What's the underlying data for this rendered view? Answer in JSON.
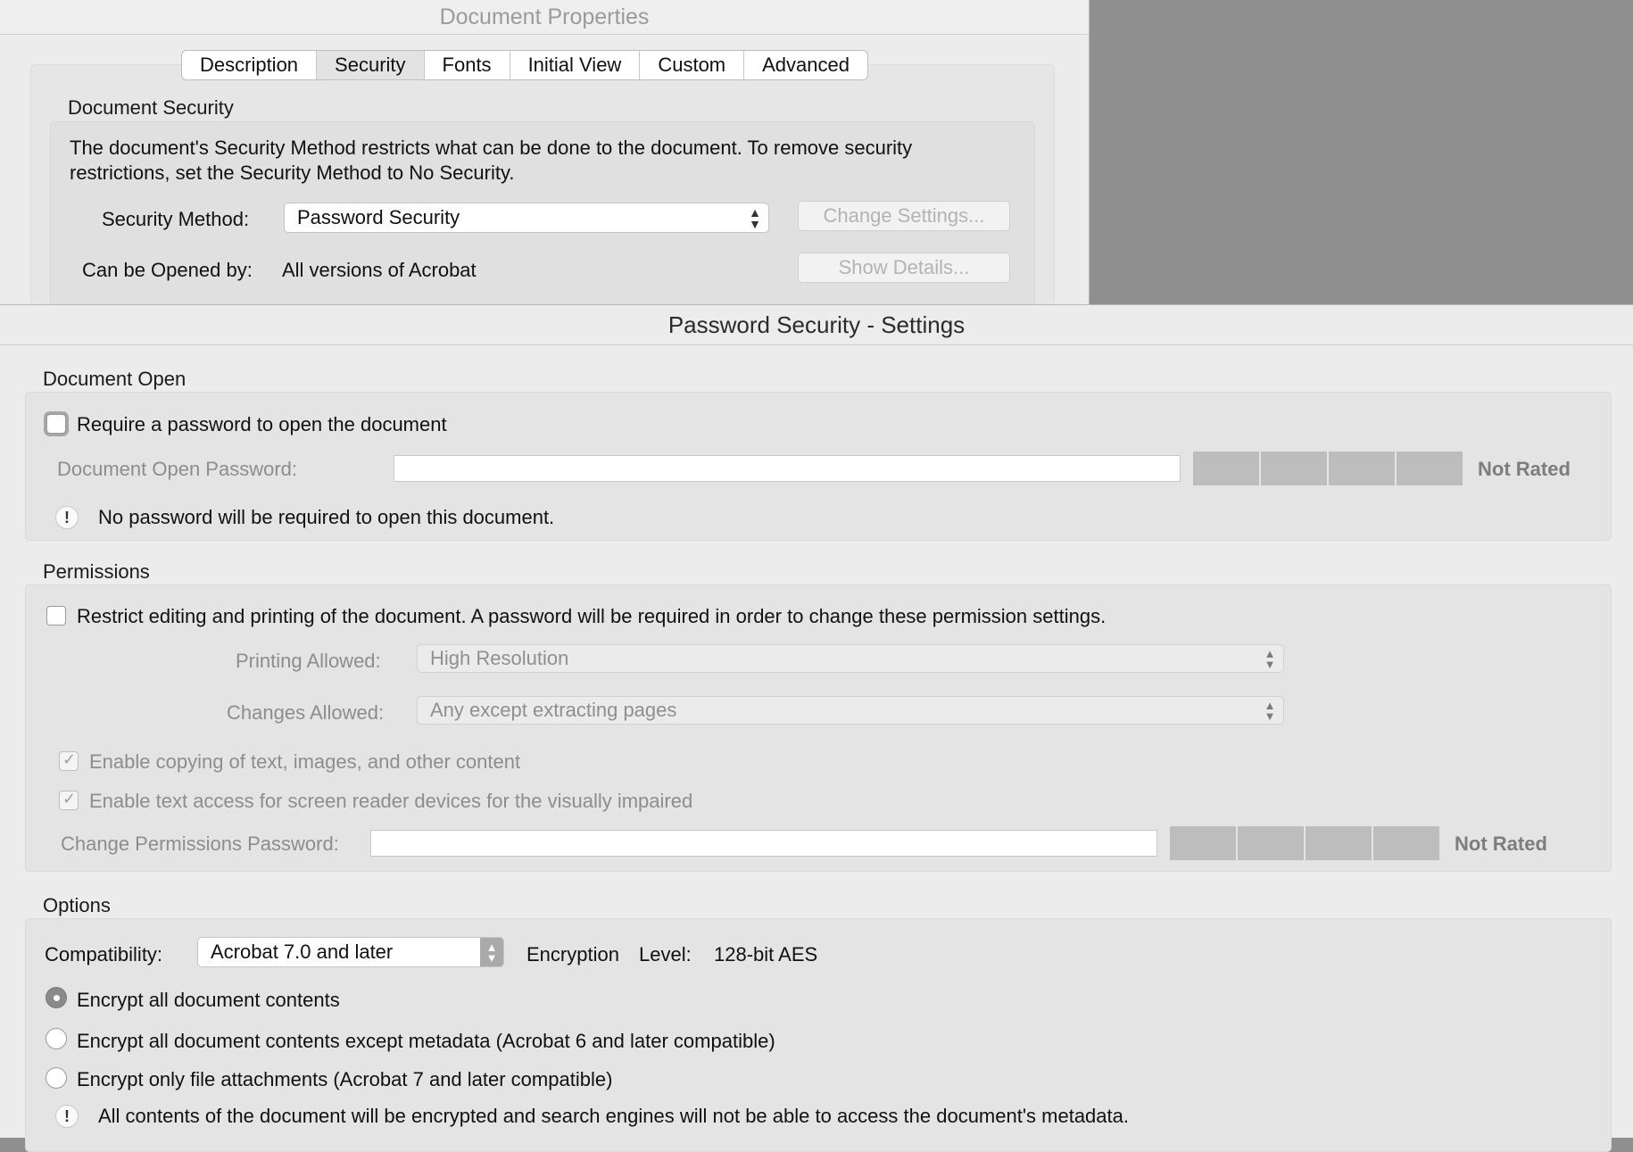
{
  "doc_properties": {
    "title": "Document Properties",
    "tabs": [
      "Description",
      "Security",
      "Fonts",
      "Initial View",
      "Custom",
      "Advanced"
    ],
    "active_tab": "Security",
    "group_title": "Document Security",
    "description": "The document's Security Method restricts what can be done to the document. To remove security restrictions, set the Security Method to No Security.",
    "security_method_label": "Security Method:",
    "security_method_value": "Password Security",
    "change_settings_label": "Change Settings...",
    "opened_by_label": "Can be Opened by:",
    "opened_by_value": "All versions of Acrobat",
    "show_details_label": "Show Details..."
  },
  "settings": {
    "title": "Password Security - Settings",
    "document_open": {
      "section_title": "Document Open",
      "require_password_label": "Require a password to open the document",
      "require_password_checked": false,
      "open_password_label": "Document Open Password:",
      "open_password_value": "",
      "rating": "Not Rated",
      "notice": "No password will be required to open this document."
    },
    "permissions": {
      "section_title": "Permissions",
      "restrict_label": "Restrict editing and printing of the document. A password will be required in order to change these permission settings.",
      "restrict_checked": false,
      "printing_label": "Printing Allowed:",
      "printing_value": "High Resolution",
      "changes_label": "Changes Allowed:",
      "changes_value": "Any except extracting pages",
      "copy_label": "Enable copying of text, images, and other content",
      "copy_checked": true,
      "screen_reader_label": "Enable text access for screen reader devices for the visually impaired",
      "screen_reader_checked": true,
      "perm_password_label": "Change Permissions Password:",
      "perm_password_value": "",
      "rating": "Not Rated"
    },
    "options": {
      "section_title": "Options",
      "compat_label": "Compatibility:",
      "compat_value": "Acrobat 7.0 and later",
      "encryption_label": "Encryption",
      "level_label": "Level:",
      "encryption_value": "128-bit AES",
      "radio_all": "Encrypt all document contents",
      "radio_except_metadata": "Encrypt all document contents except metadata (Acrobat 6 and later compatible)",
      "radio_attachments": "Encrypt only file attachments (Acrobat 7 and later compatible)",
      "selected_radio": "Encrypt all document contents",
      "notice": "All contents of the document will be encrypted and search engines will not be able to access the document's metadata."
    }
  }
}
